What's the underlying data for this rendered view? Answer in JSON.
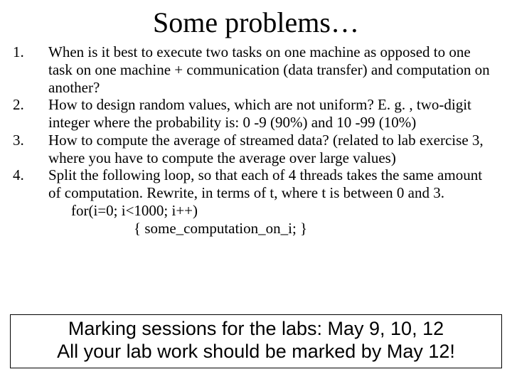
{
  "title": "Some problems…",
  "items": [
    {
      "num": "1.",
      "text": "When is it best to execute two tasks on one machine as opposed to one task on one machine + communication (data transfer) and computation on another?"
    },
    {
      "num": "2.",
      "text": "How to design random values, which are not uniform? E. g. , two-digit integer where the probability is: 0 -9 (90%) and 10 -99 (10%)"
    },
    {
      "num": "3.",
      "text": "How to compute the average of streamed data? (related to lab exercise 3, where you have to compute the average over large values)"
    },
    {
      "num": "4.",
      "text": "Split the following loop, so that each of 4 threads takes the same amount of computation. Rewrite, in terms of t, where t is between 0 and 3.",
      "code1": "for(i=0; i<1000; i++)",
      "code2": "{ some_computation_on_i; }"
    }
  ],
  "footer": {
    "line1": "Marking sessions for the labs: May 9, 10, 12",
    "line2": "All your lab work should be marked by May 12!"
  }
}
